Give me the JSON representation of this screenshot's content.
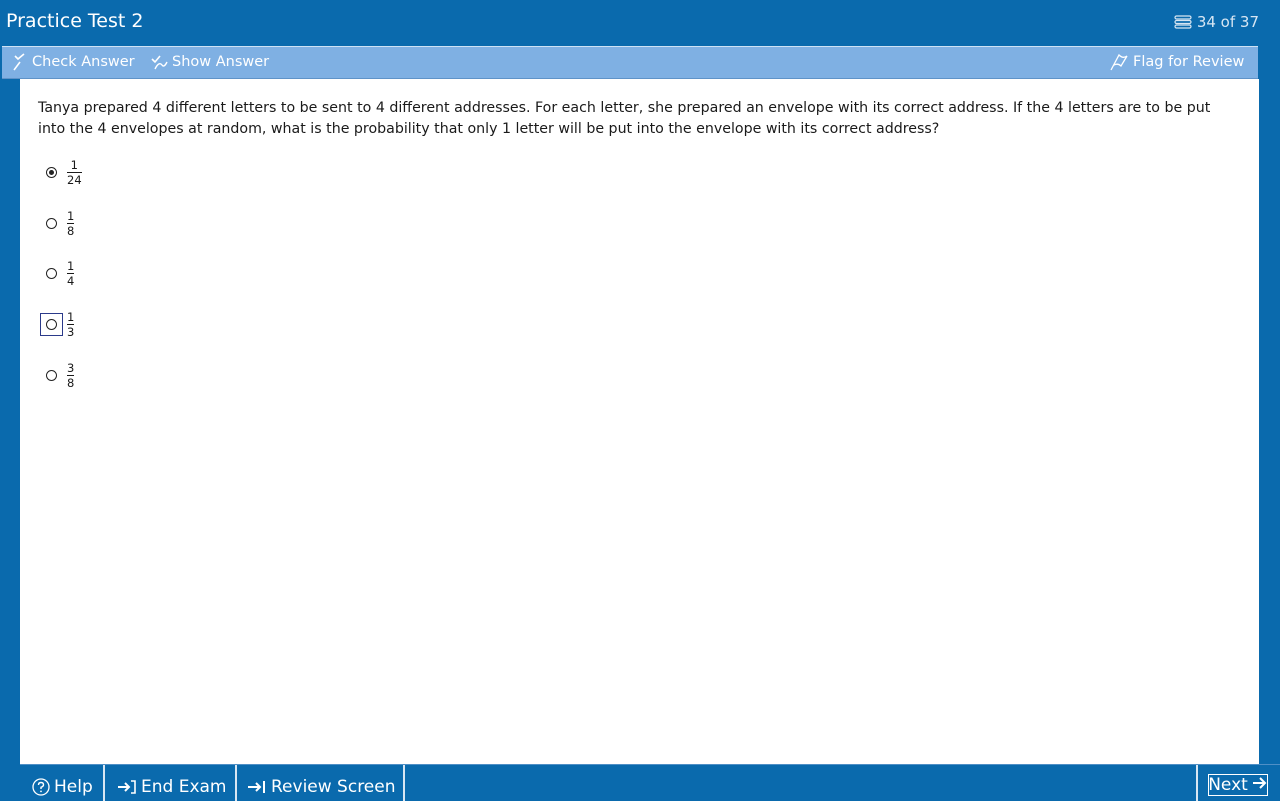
{
  "app": {
    "title": "Practice Test 2",
    "counter": "34 of 37"
  },
  "toolbar": {
    "check_answer": "Check Answer",
    "show_answer": "Show Answer",
    "flag_for_review": "Flag for Review"
  },
  "question": {
    "text": "Tanya prepared 4 different letters to be sent to 4 different addresses.  For each letter, she prepared an envelope with its correct address.  If the 4 letters are to be put into the 4 envelopes at random, what is the probability that only 1 letter will be put into the envelope with its correct address?"
  },
  "choices": [
    {
      "numerator": "1",
      "denominator": "24",
      "selected": true
    },
    {
      "numerator": "1",
      "denominator": "8",
      "selected": false
    },
    {
      "numerator": "1",
      "denominator": "4",
      "selected": false
    },
    {
      "numerator": "1",
      "denominator": "3",
      "selected": false,
      "focused": true
    },
    {
      "numerator": "3",
      "denominator": "8",
      "selected": false
    }
  ],
  "bottom": {
    "help": "Help",
    "end_exam": "End Exam",
    "review_screen": "Review Screen",
    "next": "Next"
  },
  "colors": {
    "primary": "#0a6aad",
    "toolbar": "#7fb0e3"
  }
}
